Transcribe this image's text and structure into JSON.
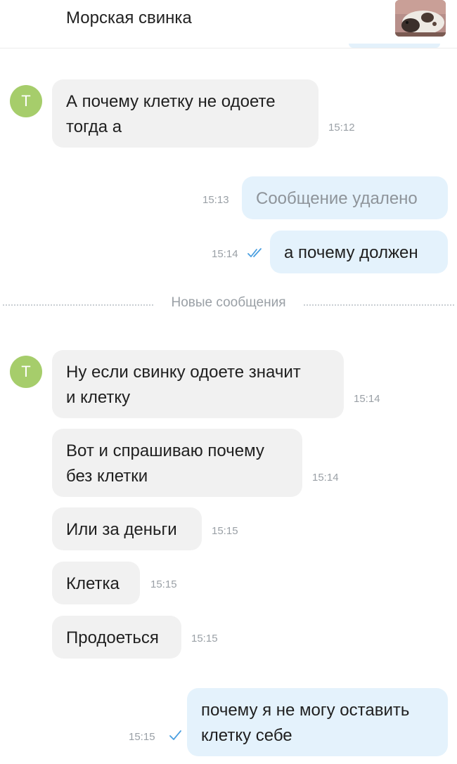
{
  "header": {
    "title": "Морская свинка",
    "thumbnail_icon": "guinea-pig-photo"
  },
  "colors": {
    "avatar": "#a6cd6b",
    "incoming_bubble": "#f1f1f1",
    "outgoing_bubble": "#e4f2fc",
    "read_check": "#4a9fe0"
  },
  "avatar_letter": "T",
  "divider": {
    "label": "Новые сообщения"
  },
  "messages": [
    {
      "direction": "in",
      "text": "А почему клетку не одоете\nтогда а",
      "time": "15:12"
    },
    {
      "direction": "out",
      "text": "Сообщение удалено",
      "time": "15:13",
      "deleted": true
    },
    {
      "direction": "out",
      "text": "а почему должен",
      "time": "15:14",
      "status": "read"
    },
    {
      "direction": "in",
      "text": "Ну если свинку одоете значит\nи клетку",
      "time": "15:14"
    },
    {
      "direction": "in",
      "text": "Вот и спрашиваю почему\nбез клетки",
      "time": "15:14"
    },
    {
      "direction": "in",
      "text": "Или за деньги",
      "time": "15:15"
    },
    {
      "direction": "in",
      "text": "Клетка",
      "time": "15:15"
    },
    {
      "direction": "in",
      "text": "Продоеться",
      "time": "15:15"
    },
    {
      "direction": "out",
      "text": "почему я не могу оставить\nклетку себе",
      "time": "15:15",
      "status": "sent"
    }
  ]
}
